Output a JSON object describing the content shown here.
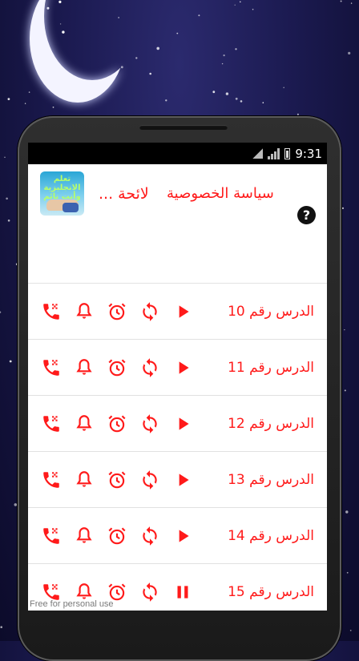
{
  "status_bar": {
    "time": "9:31"
  },
  "header": {
    "app_icon_text": "تعلم الانجليزية وأنت نائم",
    "menu_list": "لائحة ...",
    "menu_privacy": "سياسة الخصوصية",
    "help_icon": "help-circle-icon"
  },
  "lessons": [
    {
      "label": "الدرس رقم 10",
      "play_state": "play"
    },
    {
      "label": "الدرس رقم 11",
      "play_state": "play"
    },
    {
      "label": "الدرس رقم 12",
      "play_state": "play"
    },
    {
      "label": "الدرس رقم 13",
      "play_state": "play"
    },
    {
      "label": "الدرس رقم 14",
      "play_state": "play"
    },
    {
      "label": "الدرس رقم 15",
      "play_state": "pause"
    }
  ],
  "row_icons": [
    "ringtone-phone-icon",
    "notification-bell-icon",
    "alarm-clock-icon",
    "repeat-icon",
    "play-icon"
  ],
  "colors": {
    "accent": "#ff1a1a",
    "screen_bg": "#ffffff",
    "status_bar_bg": "#000000"
  },
  "watermark": "Free for personal use"
}
